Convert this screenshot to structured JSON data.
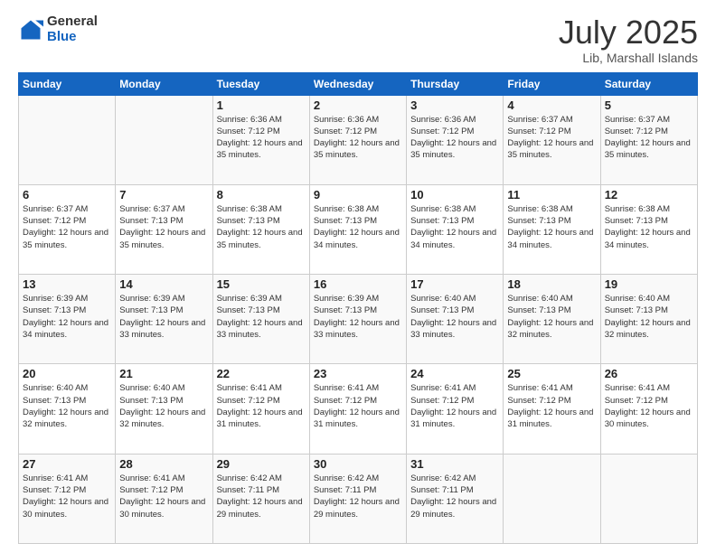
{
  "logo": {
    "general": "General",
    "blue": "Blue"
  },
  "title": {
    "month_year": "July 2025",
    "location": "Lib, Marshall Islands"
  },
  "weekdays": [
    "Sunday",
    "Monday",
    "Tuesday",
    "Wednesday",
    "Thursday",
    "Friday",
    "Saturday"
  ],
  "weeks": [
    [
      {
        "day": "",
        "info": ""
      },
      {
        "day": "",
        "info": ""
      },
      {
        "day": "1",
        "info": "Sunrise: 6:36 AM\nSunset: 7:12 PM\nDaylight: 12 hours and 35 minutes."
      },
      {
        "day": "2",
        "info": "Sunrise: 6:36 AM\nSunset: 7:12 PM\nDaylight: 12 hours and 35 minutes."
      },
      {
        "day": "3",
        "info": "Sunrise: 6:36 AM\nSunset: 7:12 PM\nDaylight: 12 hours and 35 minutes."
      },
      {
        "day": "4",
        "info": "Sunrise: 6:37 AM\nSunset: 7:12 PM\nDaylight: 12 hours and 35 minutes."
      },
      {
        "day": "5",
        "info": "Sunrise: 6:37 AM\nSunset: 7:12 PM\nDaylight: 12 hours and 35 minutes."
      }
    ],
    [
      {
        "day": "6",
        "info": "Sunrise: 6:37 AM\nSunset: 7:12 PM\nDaylight: 12 hours and 35 minutes."
      },
      {
        "day": "7",
        "info": "Sunrise: 6:37 AM\nSunset: 7:13 PM\nDaylight: 12 hours and 35 minutes."
      },
      {
        "day": "8",
        "info": "Sunrise: 6:38 AM\nSunset: 7:13 PM\nDaylight: 12 hours and 35 minutes."
      },
      {
        "day": "9",
        "info": "Sunrise: 6:38 AM\nSunset: 7:13 PM\nDaylight: 12 hours and 34 minutes."
      },
      {
        "day": "10",
        "info": "Sunrise: 6:38 AM\nSunset: 7:13 PM\nDaylight: 12 hours and 34 minutes."
      },
      {
        "day": "11",
        "info": "Sunrise: 6:38 AM\nSunset: 7:13 PM\nDaylight: 12 hours and 34 minutes."
      },
      {
        "day": "12",
        "info": "Sunrise: 6:38 AM\nSunset: 7:13 PM\nDaylight: 12 hours and 34 minutes."
      }
    ],
    [
      {
        "day": "13",
        "info": "Sunrise: 6:39 AM\nSunset: 7:13 PM\nDaylight: 12 hours and 34 minutes."
      },
      {
        "day": "14",
        "info": "Sunrise: 6:39 AM\nSunset: 7:13 PM\nDaylight: 12 hours and 33 minutes."
      },
      {
        "day": "15",
        "info": "Sunrise: 6:39 AM\nSunset: 7:13 PM\nDaylight: 12 hours and 33 minutes."
      },
      {
        "day": "16",
        "info": "Sunrise: 6:39 AM\nSunset: 7:13 PM\nDaylight: 12 hours and 33 minutes."
      },
      {
        "day": "17",
        "info": "Sunrise: 6:40 AM\nSunset: 7:13 PM\nDaylight: 12 hours and 33 minutes."
      },
      {
        "day": "18",
        "info": "Sunrise: 6:40 AM\nSunset: 7:13 PM\nDaylight: 12 hours and 32 minutes."
      },
      {
        "day": "19",
        "info": "Sunrise: 6:40 AM\nSunset: 7:13 PM\nDaylight: 12 hours and 32 minutes."
      }
    ],
    [
      {
        "day": "20",
        "info": "Sunrise: 6:40 AM\nSunset: 7:13 PM\nDaylight: 12 hours and 32 minutes."
      },
      {
        "day": "21",
        "info": "Sunrise: 6:40 AM\nSunset: 7:13 PM\nDaylight: 12 hours and 32 minutes."
      },
      {
        "day": "22",
        "info": "Sunrise: 6:41 AM\nSunset: 7:12 PM\nDaylight: 12 hours and 31 minutes."
      },
      {
        "day": "23",
        "info": "Sunrise: 6:41 AM\nSunset: 7:12 PM\nDaylight: 12 hours and 31 minutes."
      },
      {
        "day": "24",
        "info": "Sunrise: 6:41 AM\nSunset: 7:12 PM\nDaylight: 12 hours and 31 minutes."
      },
      {
        "day": "25",
        "info": "Sunrise: 6:41 AM\nSunset: 7:12 PM\nDaylight: 12 hours and 31 minutes."
      },
      {
        "day": "26",
        "info": "Sunrise: 6:41 AM\nSunset: 7:12 PM\nDaylight: 12 hours and 30 minutes."
      }
    ],
    [
      {
        "day": "27",
        "info": "Sunrise: 6:41 AM\nSunset: 7:12 PM\nDaylight: 12 hours and 30 minutes."
      },
      {
        "day": "28",
        "info": "Sunrise: 6:41 AM\nSunset: 7:12 PM\nDaylight: 12 hours and 30 minutes."
      },
      {
        "day": "29",
        "info": "Sunrise: 6:42 AM\nSunset: 7:11 PM\nDaylight: 12 hours and 29 minutes."
      },
      {
        "day": "30",
        "info": "Sunrise: 6:42 AM\nSunset: 7:11 PM\nDaylight: 12 hours and 29 minutes."
      },
      {
        "day": "31",
        "info": "Sunrise: 6:42 AM\nSunset: 7:11 PM\nDaylight: 12 hours and 29 minutes."
      },
      {
        "day": "",
        "info": ""
      },
      {
        "day": "",
        "info": ""
      }
    ]
  ]
}
